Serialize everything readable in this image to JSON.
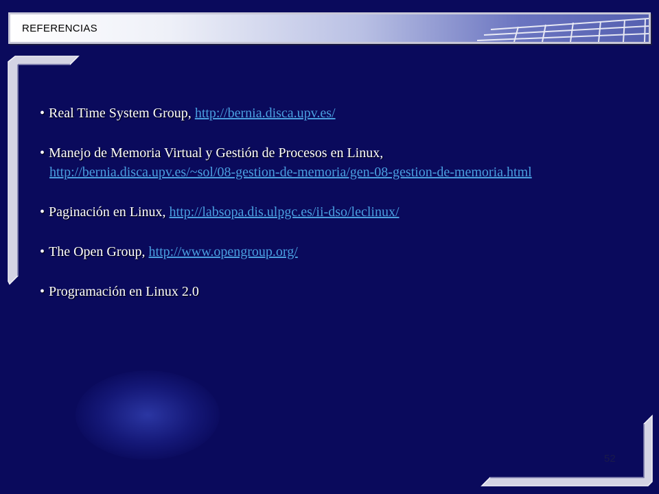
{
  "header": {
    "title": "REFERENCIAS"
  },
  "references": [
    {
      "text": "Real Time System Group, ",
      "link": "http://bernia.disca.upv.es/"
    },
    {
      "text": "Manejo de Memoria Virtual y Gestión de Procesos en Linux,",
      "link": "http://bernia.disca.upv.es/~sol/08-gestion-de-memoria/gen-08-gestion-de-memoria.html"
    },
    {
      "text": "Paginación en Linux, ",
      "link": "http://labsopa.dis.ulpgc.es/ii-dso/leclinux/"
    },
    {
      "text": "The Open Group, ",
      "link": "http://www.opengroup.org/"
    },
    {
      "text": "Programación en Linux 2.0"
    }
  ],
  "bullet": "•",
  "page_number": "52",
  "colors": {
    "background": "#0a0a5c",
    "link": "#4a9fe0",
    "text": "#ffffff"
  }
}
